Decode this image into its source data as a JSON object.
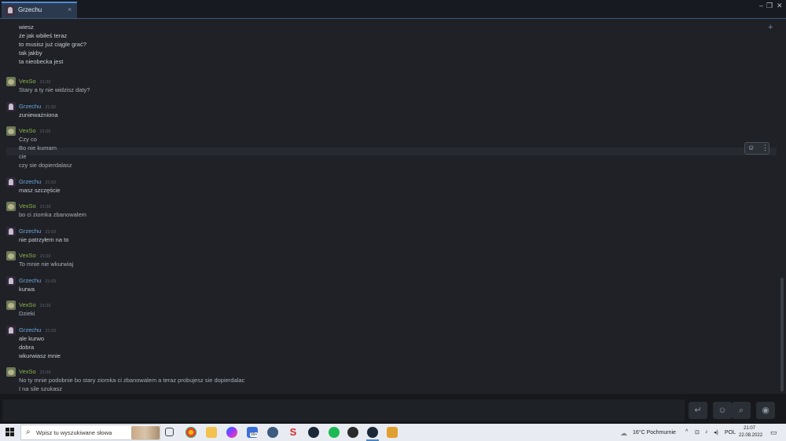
{
  "window": {
    "tab_title": "Grzechu",
    "tab_close": "×",
    "minimize": "–",
    "maximize": "❐",
    "close": "✕"
  },
  "chat": {
    "add_friend_icon": "+",
    "top_lines": [
      "wiesz",
      "że jak wbiłeś teraz",
      "to musisz już ciągle grać?",
      "tak jakby",
      "ta nieobecka jest"
    ],
    "groups": [
      {
        "author": "VexSo",
        "time": "21:02",
        "lines": [
          "Stary a ty nie widzisz daty?"
        ]
      },
      {
        "author": "Grzechu",
        "time": "21:02",
        "lines": [
          "zunieważniona"
        ]
      },
      {
        "author": "VexSo",
        "time": "21:02",
        "lines": [
          "Czy co",
          "Bo nie kumam",
          "cie",
          "czy sie dopierdalasz"
        ]
      },
      {
        "author": "Grzechu",
        "time": "21:02",
        "lines": [
          "masz szczęście"
        ]
      },
      {
        "author": "VexSo",
        "time": "21:03",
        "lines": [
          "bo ci ziomka zbanowalem"
        ]
      },
      {
        "author": "Grzechu",
        "time": "21:03",
        "lines": [
          "nie patrzyłem na to"
        ]
      },
      {
        "author": "VexSo",
        "time": "21:03",
        "lines": [
          "To mnie nie wkurwiaj"
        ]
      },
      {
        "author": "Grzechu",
        "time": "21:03",
        "lines": [
          "kurwa"
        ]
      },
      {
        "author": "VexSo",
        "time": "21:03",
        "lines": [
          "Dzieki"
        ]
      },
      {
        "author": "Grzechu",
        "time": "21:03",
        "lines": [
          "ale kurwo",
          "dobra",
          "wkurwiasz mnie"
        ]
      },
      {
        "author": "VexSo",
        "time": "21:03",
        "lines": [
          "No ty mnie podobnie bo stary ziomka ci zbanowalem a teraz probujesz sie dopierdalac",
          "I na sile szukasz"
        ]
      }
    ]
  },
  "inputbar": {
    "send_icon": "↵",
    "emoji_icon": "☺",
    "attach_icon": "⌕",
    "voice_icon": "◉"
  },
  "taskbar": {
    "search_placeholder": "Wpisz tu wyszukiwane słowa",
    "search_icon": "⌕",
    "mail_badge": "99+",
    "weather": "16°C  Pochmurnie",
    "language": "POL",
    "time": "21:07",
    "date": "22.08.2022"
  }
}
